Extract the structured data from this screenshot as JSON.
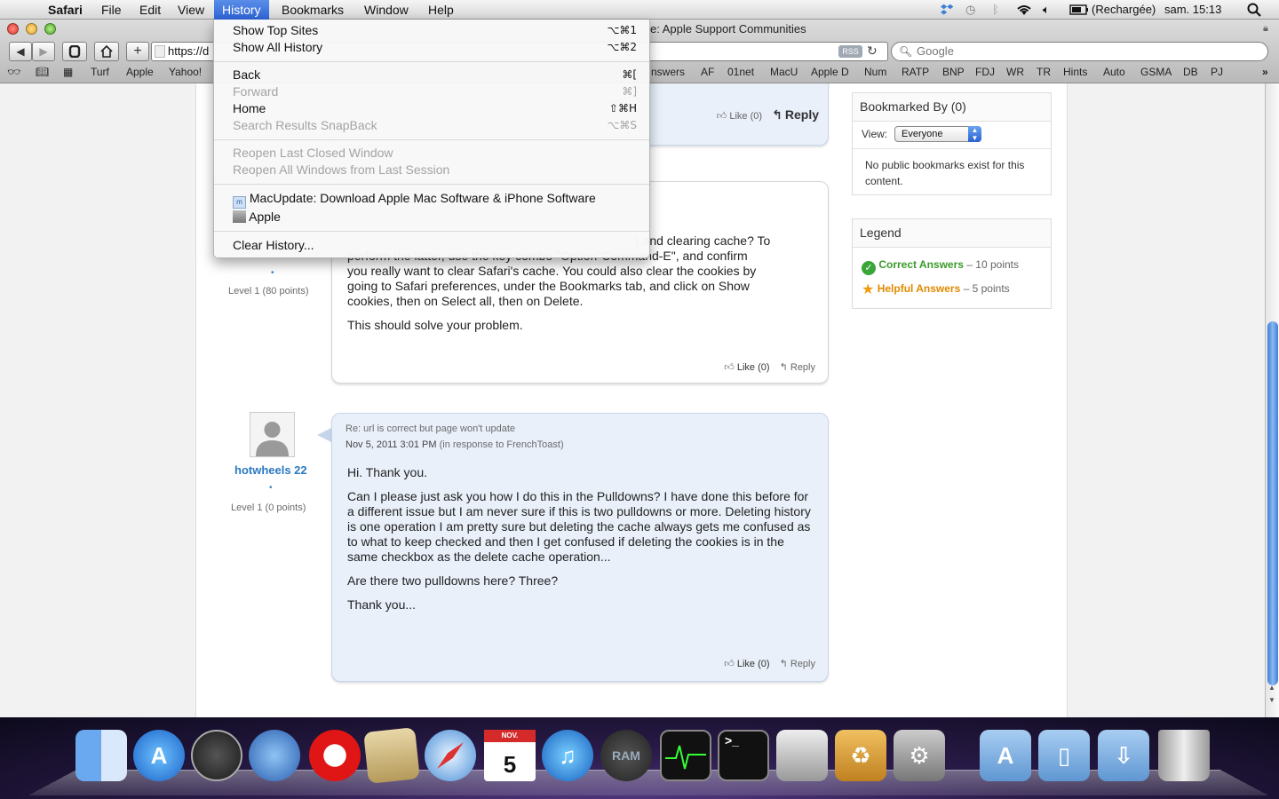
{
  "menubar": {
    "app": "Safari",
    "items": [
      "File",
      "Edit",
      "View",
      "History",
      "Bookmarks",
      "Window",
      "Help"
    ],
    "battery": "(Rechargée)",
    "clock": "sam. 15:13"
  },
  "window": {
    "title": "e: Apple Support Communities",
    "url": "https://d",
    "rss_label": "RSS",
    "search_placeholder": "Google"
  },
  "bookmarks_left": [
    "Turf",
    "Apple",
    "Yahoo!"
  ],
  "bookmarks_right": [
    "nswers",
    "AF",
    "01net",
    "MacU",
    "Apple D",
    "Num",
    "RATP",
    "BNP",
    "FDJ",
    "WR",
    "TR",
    "Hints",
    "Auto",
    "GSMA",
    "DB",
    "PJ"
  ],
  "history_menu": {
    "show_top_sites": {
      "label": "Show Top Sites",
      "shortcut": "⌥⌘1"
    },
    "show_all_history": {
      "label": "Show All History",
      "shortcut": "⌥⌘2"
    },
    "back": {
      "label": "Back",
      "shortcut": "⌘["
    },
    "forward": {
      "label": "Forward",
      "shortcut": "⌘]"
    },
    "home": {
      "label": "Home",
      "shortcut": "⇧⌘H"
    },
    "snapback": {
      "label": "Search Results SnapBack",
      "shortcut": "⌥⌘S"
    },
    "reopen_window": {
      "label": "Reopen Last Closed Window"
    },
    "reopen_session": {
      "label": "Reopen All Windows from Last Session"
    },
    "recent_1": {
      "label": "MacUpdate: Download Apple Mac Software & iPhone Software"
    },
    "recent_2": {
      "label": "Apple"
    },
    "clear": {
      "label": "Clear History..."
    }
  },
  "post_top": {
    "like": "Like (0)",
    "reply": "Reply"
  },
  "post_mid": {
    "level": "Level 1 (80 points)",
    "lines": [
      ") and clearing cache? To",
      "perform the latter, use the key combo \"Option\"Command-E\", and confirm",
      "you really want to clear Safari's cache. You could also clear the cookies by",
      "going to Safari preferences, under the Bookmarks tab, and click on Show",
      "cookies, then on Select all, then on Delete."
    ],
    "para2": "This should solve your problem.",
    "like": "Like (0)",
    "reply": "Reply"
  },
  "post_bottom": {
    "username": "hotwheels 22",
    "level": "Level 1 (0 points)",
    "subject": "Re: url is correct but page won't update",
    "date": "Nov 5, 2011 3:01 PM",
    "in_response": "(in response to FrenchToast)",
    "para1": "Hi. Thank you.",
    "para2": "Can I please just ask you how I do this in the Pulldowns? I have done this before for a different issue but I am never sure if this is two pulldowns or more. Deleting history is one operation I am pretty sure but deleting the cache always gets me confused as to what to keep checked and then I get confused if deleting the cookies is in the same checkbox as the delete cache operation...",
    "para3": "Are there two pulldowns here? Three?",
    "para4": "Thank you...",
    "like": "Like (0)",
    "reply": "Reply"
  },
  "sidebar": {
    "bookmarked_title": "Bookmarked By (0)",
    "view_label": "View:",
    "view_value": "Everyone",
    "no_bookmarks": "No public bookmarks exist for this content.",
    "legend_title": "Legend",
    "correct_label": "Correct Answers",
    "correct_points": "– 10 points",
    "helpful_label": "Helpful Answers",
    "helpful_points": "– 5 points"
  },
  "dock": {
    "calendar_month": "NOV.",
    "calendar_day": "5",
    "ram_label": "RAM"
  }
}
